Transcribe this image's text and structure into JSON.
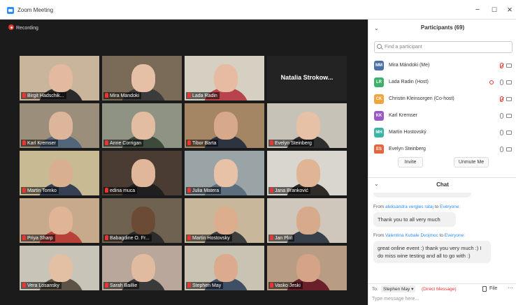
{
  "window": {
    "title": "Zoom Meeting",
    "controls": {
      "minimize": "−",
      "maximize": "☐",
      "close": "×"
    }
  },
  "video": {
    "recording_label": "Recording",
    "tiles": [
      {
        "name": "Birgit Hadschik...",
        "bg": "#c9b49c",
        "skin": "#e3b9a0",
        "shirt": "#2b2b2b"
      },
      {
        "name": "Mira Mandoki",
        "bg": "#7a6a58",
        "skin": "#e6c0a6",
        "shirt": "#3b3b3b"
      },
      {
        "name": "Lada Radin",
        "bg": "#d6d0c3",
        "skin": "#e7bba2",
        "shirt": "#b8434d",
        "active": true
      },
      {
        "name": "Natalia Strokow...",
        "name_only": true
      },
      {
        "name": "Karl Kremser",
        "bg": "#9b8e7a",
        "skin": "#dcb59b",
        "shirt": "#52657a"
      },
      {
        "name": "Anne Corrigan",
        "bg": "#8f9383",
        "skin": "#e2bda2",
        "shirt": "#3c4a3c"
      },
      {
        "name": "Tibor Barta",
        "bg": "#a48664",
        "skin": "#d8a88a",
        "shirt": "#2c3440"
      },
      {
        "name": "Evelyn Steinberg",
        "bg": "#c7c2b8",
        "skin": "#e6c1a6",
        "shirt": "#2e2e2e"
      },
      {
        "name": "Martin Tomko",
        "bg": "#c8ba92",
        "skin": "#d9b08f",
        "shirt": "#354055"
      },
      {
        "name": "edina muca",
        "bg": "#4a3c33",
        "skin": "#e0b79b",
        "shirt": "#1f1f1f"
      },
      {
        "name": "Julia Matera",
        "bg": "#9aa3a6",
        "skin": "#e7c2a7",
        "shirt": "#5b6e7d"
      },
      {
        "name": "Jana Branković",
        "bg": "#d9d6cf",
        "skin": "#dfb596",
        "shirt": "#2e2b29"
      },
      {
        "name": "Priya Sharp",
        "bg": "#c7a98c",
        "skin": "#dfb595",
        "shirt": "#b8413a"
      },
      {
        "name": "Babagdine O. Fr...",
        "bg": "#6f6250",
        "skin": "#6b4a36",
        "shirt": "#2c2c2c"
      },
      {
        "name": "Martin Hostovsky",
        "bg": "#c9b79b",
        "skin": "#dcae8e",
        "shirt": "#3e3e3e"
      },
      {
        "name": "Jan Plut",
        "bg": "#cfc7bb",
        "skin": "#d7aa8b",
        "shirt": "#37404a"
      },
      {
        "name": "Vera Losansky",
        "bg": "#c9c4b8",
        "skin": "#e3bfa3",
        "shirt": "#5c5246"
      },
      {
        "name": "Sarah Baillie",
        "bg": "#b8a79a",
        "skin": "#e1bb9f",
        "shirt": "#3a3a3a"
      },
      {
        "name": "Stephen May",
        "bg": "#c9c3b3",
        "skin": "#dcaa8d",
        "shirt": "#3f4f66"
      },
      {
        "name": "Vasko Jeski",
        "bg": "#b89d84",
        "skin": "#d5a386",
        "shirt": "#6b1f2a"
      }
    ]
  },
  "participants": {
    "title": "Participants (69)",
    "search_placeholder": "Find a participant",
    "list": [
      {
        "initials": "MM",
        "name": "Mira Mándoki (Me)",
        "color": "#4b6fa8",
        "muted": true
      },
      {
        "initials": "LR",
        "name": "Lada Radin (Host)",
        "color": "#3db06b",
        "muted": false,
        "recording": true
      },
      {
        "initials": "CK",
        "name": "Christin Kleinsorgen (Co-host)",
        "color": "#f0a43a",
        "muted": true
      },
      {
        "initials": "KK",
        "name": "Karl Kremser",
        "color": "#9b59c7",
        "muted": false
      },
      {
        "initials": "MH",
        "name": "Martin Hostovský",
        "color": "#38b3a4",
        "muted": false
      },
      {
        "initials": "ES",
        "name": "Evelyn Steinberg",
        "color": "#e8643c",
        "muted": false
      }
    ],
    "invite_label": "Invite",
    "unmute_label": "Unmute Me"
  },
  "chat": {
    "title": "Chat",
    "messages": [
      {
        "from_prefix": "From",
        "from": "aleksandra vergles rataj",
        "to_prefix": "to",
        "to": "Everyone:",
        "text": "Thank you to all very much"
      },
      {
        "from_prefix": "From",
        "from": "Valentina Kubale Dvojmoc",
        "to_prefix": "to",
        "to": "Everyone:",
        "text": "great online event :) thank you very much :) I do miss wine testing and all to go with :)"
      }
    ],
    "to_label": "To:",
    "to_value": "Stephen May ▾",
    "direct_label": "(Direct Message)",
    "file_label": "File",
    "more_label": "···",
    "input_placeholder": "Type message here..."
  }
}
